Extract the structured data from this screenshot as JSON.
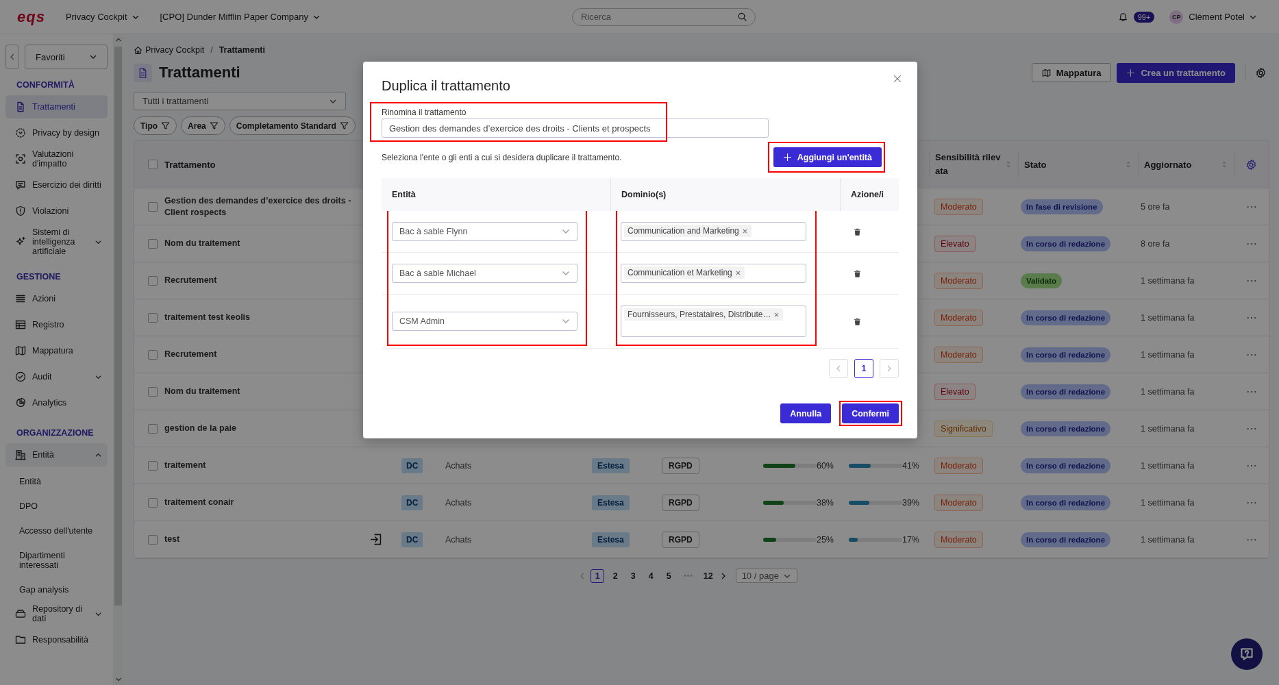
{
  "topbar": {
    "logo": "eqs",
    "app_menu": "Privacy Cockpit",
    "company_menu": "[CPO] Dunder Mifflin Paper Company",
    "search": {
      "placeholder": "Ricerca"
    },
    "notifications": "99+",
    "user": {
      "initials": "CP",
      "name": "Clément Potel"
    }
  },
  "sidebar": {
    "favorites": "Favoriti",
    "sections": [
      {
        "title": "CONFORMITÀ",
        "items": [
          {
            "label": "Trattamenti",
            "selected": true
          },
          {
            "label": "Privacy by design",
            "selected": false
          },
          {
            "label": "Valutazioni d'impatto",
            "selected": false
          },
          {
            "label": "Esercizio dei diritti",
            "selected": false
          },
          {
            "label": "Violazioni",
            "selected": false
          },
          {
            "label": "Sistemi di intelligenza artificiale",
            "selected": false,
            "expanded": false
          }
        ]
      },
      {
        "title": "GESTIONE",
        "items": [
          {
            "label": "Azioni",
            "selected": false
          },
          {
            "label": "Registro",
            "selected": false
          },
          {
            "label": "Mappatura",
            "selected": false
          },
          {
            "label": "Audit",
            "selected": false,
            "expanded": false
          },
          {
            "label": "Analytics",
            "selected": false
          }
        ]
      },
      {
        "title": "ORGANIZZAZIONE",
        "items": [
          {
            "label": "Entità",
            "selected": false,
            "expanded": true,
            "children": [
              {
                "label": "Entità"
              },
              {
                "label": "DPO"
              },
              {
                "label": "Accesso dell'utente"
              },
              {
                "label": "Dipartimenti interessati"
              },
              {
                "label": "Gap analysis"
              }
            ]
          },
          {
            "label": "Repository di dati",
            "selected": false,
            "expanded": false
          },
          {
            "label": "Responsabilità",
            "selected": false
          }
        ]
      }
    ]
  },
  "breadcrumb": [
    "Privacy Cockpit",
    "Trattamenti"
  ],
  "breadcrumb_separator": "/",
  "page_title": "Trattamenti",
  "actions": {
    "map_button": "Mappatura",
    "create_button": "Crea un trattamento"
  },
  "view_select": "Tutti i trattamenti",
  "filters": [
    "Tipo",
    "Area",
    "Completamento Standard"
  ],
  "table": {
    "header_checked": false,
    "columns": {
      "name": "Trattamento",
      "sensitivity": "Sensibilità rilevata",
      "status": "Stato",
      "updated": "Aggiornato"
    },
    "rows": [
      {
        "checked": false,
        "name": "Gestion des demandes d’exercice des droits - Client rospects",
        "sensitivity": {
          "label": "Moderato",
          "kind": "moderate"
        },
        "status": {
          "label": "In fase di revisione",
          "kind": "review"
        },
        "updated": "5 ore fa"
      },
      {
        "checked": false,
        "name": "Nom du traitement",
        "sensitivity": {
          "label": "Elevato",
          "kind": "high"
        },
        "status": {
          "label": "In corso di redazione",
          "kind": "draft"
        },
        "updated": "8 ore fa"
      },
      {
        "checked": false,
        "name": "Recrutement",
        "sensitivity": {
          "label": "Moderato",
          "kind": "moderate"
        },
        "status": {
          "label": "Validato",
          "kind": "validated"
        },
        "updated": "1 settimana fa"
      },
      {
        "checked": false,
        "name": "traitement test keolis",
        "sensitivity": {
          "label": "Moderato",
          "kind": "moderate"
        },
        "status": {
          "label": "In corso di redazione",
          "kind": "draft"
        },
        "updated": "1 settimana fa"
      },
      {
        "checked": false,
        "name": "Recrutement",
        "sensitivity": {
          "label": "Moderato",
          "kind": "moderate"
        },
        "status": {
          "label": "In corso di redazione",
          "kind": "draft"
        },
        "updated": "1 settimana fa"
      },
      {
        "checked": false,
        "name": "Nom du traitement",
        "sensitivity": {
          "label": "Elevato",
          "kind": "high"
        },
        "status": {
          "label": "In corso di redazione",
          "kind": "draft"
        },
        "updated": "1 settimana fa"
      },
      {
        "checked": false,
        "name": "gestion de la paie",
        "sensitivity": {
          "label": "Significativo",
          "kind": "significant"
        },
        "status": {
          "label": "In corso di redazione",
          "kind": "draft"
        },
        "updated": "1 settimana fa"
      },
      {
        "checked": false,
        "name": "traitement",
        "owner": "DC",
        "area": "Achats",
        "scope": "Estesa",
        "framework": "RGPD",
        "progress": {
          "level": 0.6,
          "reading": "60%"
        },
        "completion": {
          "level": 0.41,
          "reading": "41%"
        },
        "sensitivity": {
          "label": "Moderato",
          "kind": "moderate"
        },
        "status": {
          "label": "In corso di redazione",
          "kind": "draft"
        },
        "updated": "1 settimana fa"
      },
      {
        "checked": false,
        "name": "traitement conair",
        "owner": "DC",
        "area": "Achats",
        "scope": "Estesa",
        "framework": "RGPD",
        "progress": {
          "level": 0.38,
          "reading": "38%"
        },
        "completion": {
          "level": 0.39,
          "reading": "39%"
        },
        "sensitivity": {
          "label": "Moderato",
          "kind": "moderate"
        },
        "status": {
          "label": "In corso di redazione",
          "kind": "draft"
        },
        "updated": "1 settimana fa"
      },
      {
        "checked": false,
        "name": "test",
        "action_icon": true,
        "owner": "DC",
        "area": "Achats",
        "scope": "Estesa",
        "framework": "RGPD",
        "progress": {
          "level": 0.25,
          "reading": "25%"
        },
        "completion": {
          "level": 0.17,
          "reading": "17%"
        },
        "sensitivity": {
          "label": "Moderato",
          "kind": "moderate"
        },
        "status": {
          "label": "In corso di redazione",
          "kind": "draft"
        },
        "updated": "1 settimana fa"
      }
    ]
  },
  "pagination": {
    "pages": [
      {
        "kind": "page",
        "label": "1",
        "selected": true
      },
      {
        "kind": "page",
        "label": "2",
        "selected": false
      },
      {
        "kind": "page",
        "label": "3",
        "selected": false
      },
      {
        "kind": "page",
        "label": "4",
        "selected": false
      },
      {
        "kind": "page",
        "label": "5",
        "selected": false
      },
      {
        "kind": "ellipsis",
        "label": "•••"
      },
      {
        "kind": "page",
        "label": "12",
        "selected": false
      }
    ],
    "page_size": "10 / page"
  },
  "modal": {
    "title": "Duplica il trattamento",
    "rename": {
      "label": "Rinomina il trattamento",
      "value": "Gestion des demandes d’exercice des droits - Clients et prospects",
      "highlighted": true
    },
    "hint": "Seleziona l'ente o gli enti a cui si desidera duplicare il trattamento.",
    "add_button": {
      "label": "Aggiungi un'entità",
      "highlighted": true
    },
    "columns": [
      {
        "label": "Entità",
        "highlighted": true
      },
      {
        "label": "Dominio(s)",
        "highlighted": true
      },
      {
        "label": "Azione/i",
        "highlighted": false
      }
    ],
    "rows": [
      {
        "entity": "Bac à sable Flynn",
        "domains": [
          "Communication and Marketing"
        ]
      },
      {
        "entity": "Bac à sable Michael",
        "domains": [
          "Communication et Marketing"
        ]
      },
      {
        "entity": "CSM Admin",
        "domains": [
          "Fournisseurs, Prestataires, Distribute…"
        ]
      }
    ],
    "pages": [
      {
        "label": "1",
        "selected": true
      }
    ],
    "cancel_button": {
      "label": "Annulla"
    },
    "confirm_button": {
      "label": "Confermi",
      "highlighted": true
    }
  }
}
